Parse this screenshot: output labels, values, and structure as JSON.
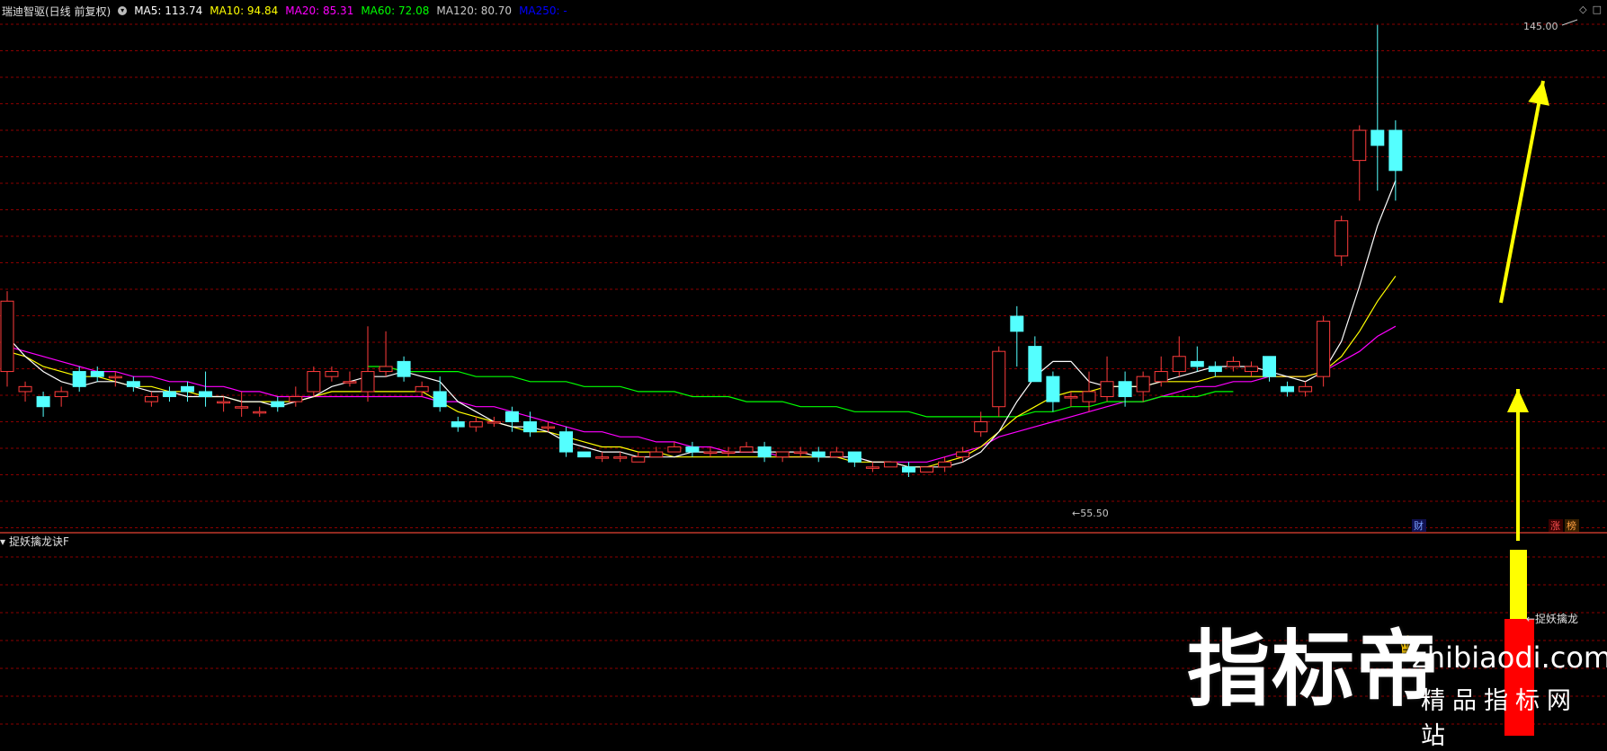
{
  "header": {
    "stock": "瑞迪智驱(日线 前复权)",
    "ma": [
      {
        "label": "MA5: 113.74",
        "color": "#ffffff"
      },
      {
        "label": "MA10: 94.84",
        "color": "#ffff00"
      },
      {
        "label": "MA20: 85.31",
        "color": "#ff00ff"
      },
      {
        "label": "MA60: 72.08",
        "color": "#00ff00"
      },
      {
        "label": "MA120: 80.70",
        "color": "#c8c8c8"
      },
      {
        "label": "MA250: -",
        "color": "#0000ff"
      }
    ]
  },
  "indicator": {
    "name": "捉妖擒龙诀F",
    "signal_label": "←捉妖擒龙"
  },
  "chart_data": {
    "type": "candlestick",
    "price_range": [
      55.5,
      145.0
    ],
    "high_label": "145.00",
    "low_label": "←55.50",
    "bottom_tags": [
      "财",
      "涨",
      "榜"
    ],
    "colors": {
      "up": "#ff3c3c",
      "down": "#54ffff",
      "ma5": "#ffffff",
      "ma10": "#ffff00",
      "ma20": "#ff00ff",
      "ma60": "#00ff00",
      "arrow": "#ffff00",
      "grid": "#8b0000"
    },
    "candles": [
      [
        76,
        90,
        73,
        92
      ],
      [
        72,
        73,
        70,
        74
      ],
      [
        71,
        69,
        67,
        72
      ],
      [
        71,
        72,
        69,
        73
      ],
      [
        76,
        73,
        72,
        77
      ],
      [
        76,
        75,
        74,
        77
      ],
      [
        75,
        75,
        73,
        76
      ],
      [
        74,
        73,
        72,
        75
      ],
      [
        70,
        71,
        69,
        72
      ],
      [
        72,
        71,
        70,
        73
      ],
      [
        73,
        72,
        70,
        74
      ],
      [
        72,
        71,
        69,
        76
      ],
      [
        70,
        70,
        68,
        71
      ],
      [
        69,
        69,
        67,
        72
      ],
      [
        68,
        68,
        67,
        69
      ],
      [
        70,
        69,
        68,
        71
      ],
      [
        70,
        71,
        69,
        73
      ],
      [
        72,
        76,
        71,
        77
      ],
      [
        75,
        76,
        74,
        77
      ],
      [
        74,
        74,
        73,
        76
      ],
      [
        72,
        76,
        70,
        85
      ],
      [
        76,
        77,
        75,
        84
      ],
      [
        78,
        75,
        74,
        79
      ],
      [
        72,
        73,
        71,
        74
      ],
      [
        72,
        69,
        68,
        75
      ],
      [
        66,
        65,
        64,
        67
      ],
      [
        65,
        66,
        64,
        67
      ],
      [
        66,
        66,
        65,
        67
      ],
      [
        68,
        66,
        64,
        69
      ],
      [
        66,
        64,
        63,
        68
      ],
      [
        65,
        65,
        64,
        66
      ],
      [
        64,
        60,
        59,
        65
      ],
      [
        60,
        59,
        59,
        60
      ],
      [
        59,
        59,
        58,
        60
      ],
      [
        59,
        59,
        58,
        60
      ],
      [
        58,
        59,
        58,
        60
      ],
      [
        59,
        60,
        59,
        61
      ],
      [
        60,
        61,
        60,
        62
      ],
      [
        61,
        60,
        59,
        62
      ],
      [
        60,
        60,
        59,
        61
      ],
      [
        60,
        60,
        59,
        61
      ],
      [
        60,
        61,
        60,
        62
      ],
      [
        61,
        59,
        58,
        62
      ],
      [
        59,
        60,
        58,
        60
      ],
      [
        60,
        60,
        59,
        61
      ],
      [
        60,
        59,
        58,
        61
      ],
      [
        59,
        60,
        59,
        61
      ],
      [
        60,
        58,
        57,
        60
      ],
      [
        57,
        57,
        56,
        58
      ],
      [
        57,
        58,
        57,
        58
      ],
      [
        57,
        56,
        55,
        58
      ],
      [
        56,
        57,
        56,
        57
      ],
      [
        57,
        58,
        56,
        59
      ],
      [
        59,
        60,
        58,
        61
      ],
      [
        64,
        66,
        63,
        68
      ],
      [
        69,
        80,
        67,
        81
      ],
      [
        87,
        84,
        77,
        89
      ],
      [
        81,
        74,
        74,
        83
      ],
      [
        75,
        70,
        68,
        76
      ],
      [
        71,
        71,
        69,
        72
      ],
      [
        70,
        72,
        68,
        76
      ],
      [
        71,
        74,
        70,
        79
      ],
      [
        74,
        71,
        69,
        76
      ],
      [
        72,
        75,
        70,
        76
      ],
      [
        74,
        76,
        73,
        79
      ],
      [
        76,
        79,
        75,
        83
      ],
      [
        78,
        77,
        76,
        81
      ],
      [
        77,
        76,
        75,
        78
      ],
      [
        77,
        78,
        76,
        79
      ],
      [
        76,
        77,
        75,
        78
      ],
      [
        79,
        75,
        74,
        79
      ],
      [
        73,
        72,
        71,
        74
      ],
      [
        72,
        73,
        71,
        74
      ],
      [
        75,
        86,
        73,
        87
      ],
      [
        99,
        106,
        97,
        107
      ],
      [
        118,
        124,
        110,
        125
      ],
      [
        124,
        121,
        112,
        145
      ],
      [
        124,
        116,
        110,
        126
      ]
    ],
    "ma5": [
      83,
      79,
      76,
      74,
      73,
      74,
      74,
      73,
      72,
      72,
      71,
      71,
      71,
      70,
      70,
      69,
      70,
      71,
      73,
      74,
      75,
      75,
      76,
      75,
      74,
      70,
      68,
      66,
      65,
      65,
      64,
      62,
      61,
      60,
      60,
      59,
      59,
      59,
      60,
      60,
      60,
      60,
      60,
      60,
      60,
      59,
      59,
      59,
      58,
      58,
      57,
      57,
      57,
      58,
      60,
      64,
      70,
      75,
      78,
      78,
      74,
      73,
      73,
      73,
      74,
      75,
      76,
      77,
      77,
      77,
      76,
      75,
      74,
      76,
      82,
      93,
      105,
      114
    ],
    "ma10": [
      80,
      79,
      77,
      76,
      75,
      75,
      74,
      73,
      73,
      72,
      72,
      71,
      71,
      70,
      70,
      70,
      70,
      71,
      72,
      72,
      72,
      72,
      72,
      72,
      70,
      68,
      67,
      66,
      65,
      64,
      64,
      63,
      62,
      61,
      61,
      60,
      60,
      59,
      59,
      59,
      59,
      59,
      59,
      59,
      59,
      59,
      59,
      58,
      58,
      58,
      57,
      57,
      58,
      59,
      61,
      64,
      67,
      69,
      71,
      72,
      72,
      73,
      73,
      73,
      74,
      74,
      74,
      75,
      75,
      75,
      75,
      75,
      75,
      76,
      79,
      84,
      90,
      95
    ],
    "ma20": [
      81,
      80,
      79,
      78,
      77,
      76,
      76,
      75,
      75,
      74,
      74,
      73,
      73,
      72,
      72,
      71,
      71,
      71,
      71,
      71,
      71,
      71,
      71,
      71,
      70,
      70,
      69,
      69,
      68,
      67,
      66,
      65,
      64,
      64,
      63,
      63,
      62,
      62,
      61,
      61,
      60,
      60,
      60,
      59,
      59,
      59,
      59,
      59,
      58,
      58,
      58,
      58,
      59,
      60,
      61,
      63,
      64,
      65,
      66,
      67,
      68,
      69,
      70,
      70,
      71,
      72,
      73,
      73,
      74,
      74,
      75,
      75,
      75,
      76,
      78,
      80,
      83,
      85
    ],
    "ma60": [
      77,
      77,
      76,
      76,
      76,
      76,
      75,
      75,
      75,
      74,
      74,
      74,
      73,
      73,
      73,
      72,
      72,
      72,
      71,
      71,
      71,
      70,
      70,
      70,
      69,
      69,
      69,
      68,
      68,
      68,
      68,
      67,
      67,
      67,
      67,
      67,
      67,
      68,
      68,
      69,
      69,
      70,
      70,
      70,
      71,
      71,
      71,
      72,
      72
    ]
  }
}
